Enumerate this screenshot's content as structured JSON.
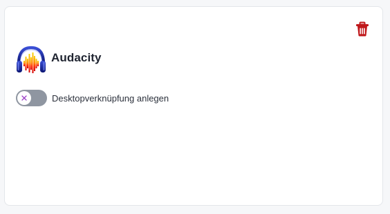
{
  "app": {
    "name": "Audacity",
    "logo_icon": "audacity-logo"
  },
  "actions": {
    "delete_icon": "trash-icon",
    "delete_color": "#c0181b"
  },
  "shortcut_toggle": {
    "label": "Desktopverknüpfung anlegen",
    "checked": false,
    "knob_icon": "x-icon",
    "knob_icon_color": "#9a3ec7",
    "track_color": "#8f96a1"
  }
}
